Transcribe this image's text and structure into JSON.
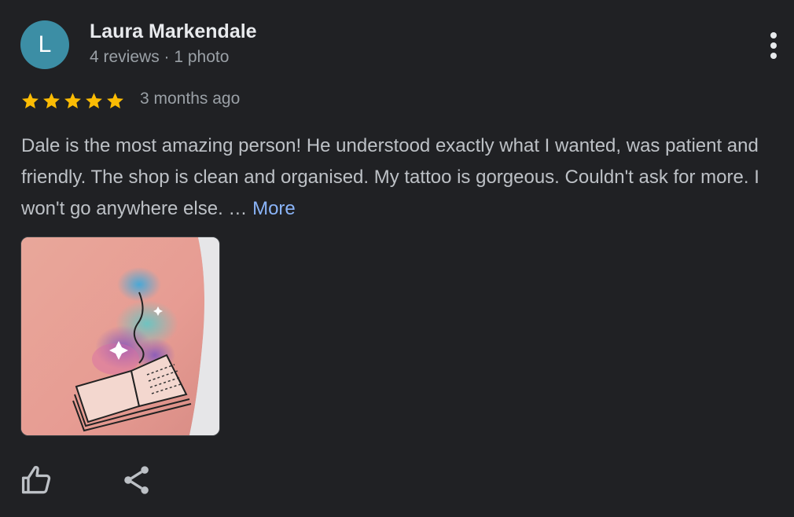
{
  "review": {
    "avatar_initial": "L",
    "avatar_color": "#3c8ea5",
    "author_name": "Laura Markendale",
    "author_meta": "4 reviews · 1 photo",
    "rating": 5,
    "rating_max": 5,
    "star_color": "#fbbc04",
    "time_ago": "3 months ago",
    "text": "Dale is the most amazing person! He understood exactly what I wanted, was patient and friendly. The shop is clean and organised. My tattoo is gorgeous. Couldn't ask for more. I won't go anywhere else. …",
    "more_label": "More",
    "more_color": "#8ab4f8"
  },
  "photo": {
    "subject": "tattoo-photo"
  },
  "actions": {
    "like_icon": "thumbs-up-icon",
    "share_icon": "share-icon",
    "menu_icon": "more-vertical-icon"
  }
}
